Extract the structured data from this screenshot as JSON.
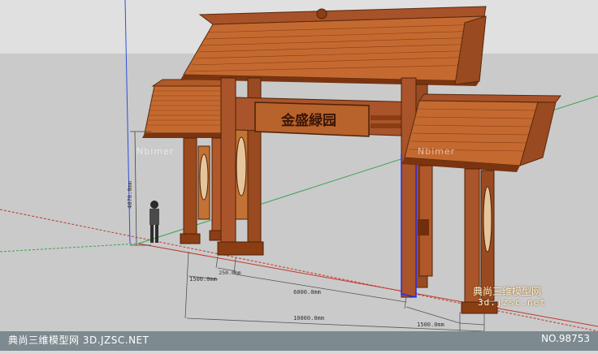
{
  "viewport": {
    "sign_text": "金盛緑园",
    "brand_watermark": "Nbimer",
    "dimensions": {
      "height": "4070.0mm",
      "span_total": "10000.0mm",
      "span_center": "6000.0mm",
      "span_left_side": "1500.0mm",
      "span_right_side": "1500.0mm",
      "span_left_post": "250.0mm"
    }
  },
  "watermarks": {
    "bottom_left": "典尚三维模型网 3D.JZSC.NET",
    "bottom_right": "NO.98753",
    "center_line1": "典尚三维模型网",
    "center_line2": "3d.jzsc.net"
  },
  "colors": {
    "background": "#d8d8d8",
    "sky": "#e0e0e0",
    "ground": "#c8c8c8",
    "wood_dark": "#8b3d14",
    "wood_mid": "#b45a24",
    "wood_light": "#cf7a3a",
    "roof": "#b8582a",
    "axis_red": "#c0392b",
    "axis_green": "#3fa34d",
    "axis_blue": "#2d4fd8",
    "selection": "#1a2cff"
  }
}
